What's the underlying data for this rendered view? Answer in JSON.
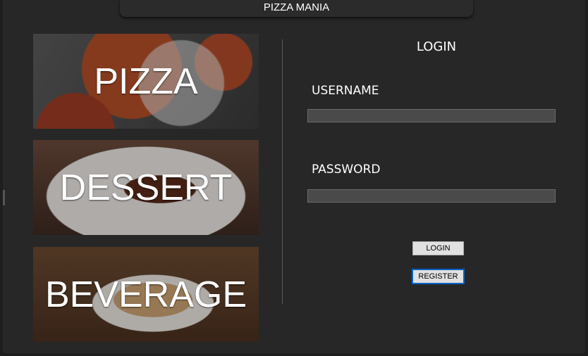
{
  "window": {
    "title": "PIZZA MANIA"
  },
  "categories": [
    {
      "label": "PIZZA"
    },
    {
      "label": "DESSERT"
    },
    {
      "label": "BEVERAGE"
    }
  ],
  "login": {
    "title": "LOGIN",
    "username_label": "USERNAME",
    "username_value": "",
    "password_label": "PASSWORD",
    "password_value": "",
    "login_button": "LOGIN",
    "register_button": "REGISTER"
  }
}
